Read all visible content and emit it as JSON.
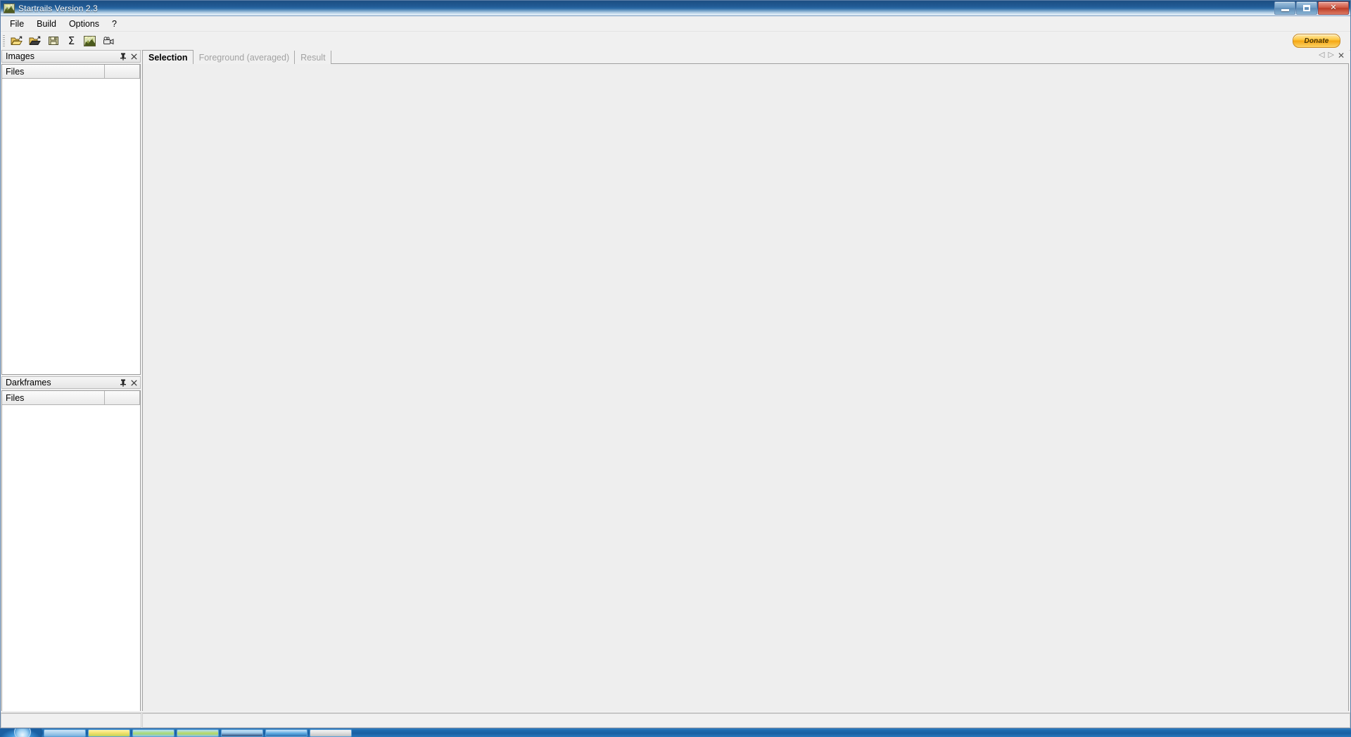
{
  "window": {
    "title": "Startrails Version 2.3",
    "icon": "startrails-app-icon",
    "controls": {
      "minimize": "minimize-button",
      "maximize": "maximize-restore-button",
      "close": "close-button"
    }
  },
  "menubar": {
    "items": [
      {
        "label": "File",
        "name": "menu-file"
      },
      {
        "label": "Build",
        "name": "menu-build"
      },
      {
        "label": "Options",
        "name": "menu-options"
      },
      {
        "label": "?",
        "name": "menu-help"
      }
    ]
  },
  "toolbar": {
    "buttons": [
      {
        "name": "open-images-button",
        "icon": "open-folder-icon",
        "tooltip": "Open images"
      },
      {
        "name": "open-darkframes-button",
        "icon": "open-folder-icon",
        "tooltip": "Open darkframes"
      },
      {
        "name": "save-button",
        "icon": "floppy-disk-save-icon",
        "tooltip": "Save"
      },
      {
        "name": "sum-button",
        "icon": "sigma-sum-icon",
        "tooltip": "Build startrails"
      },
      {
        "name": "startrails-button",
        "icon": "startrails-image-icon",
        "tooltip": "Startrails"
      },
      {
        "name": "video-button",
        "icon": "video-camera-icon",
        "tooltip": "Create video"
      }
    ],
    "donate": {
      "label": "Donate",
      "name": "donate-button",
      "color": "#f5a714"
    }
  },
  "panels": {
    "images": {
      "title": "Images",
      "pin": "pin-icon",
      "close": "close-icon",
      "columns": [
        "Files",
        ""
      ],
      "rows": []
    },
    "darkframes": {
      "title": "Darkframes",
      "pin": "pin-icon",
      "close": "close-icon",
      "columns": [
        "Files",
        ""
      ],
      "rows": []
    }
  },
  "main": {
    "tabs": [
      {
        "label": "Selection",
        "name": "tab-selection",
        "active": true
      },
      {
        "label": "Foreground (averaged)",
        "name": "tab-foreground-averaged",
        "active": false
      },
      {
        "label": "Result",
        "name": "tab-result",
        "active": false
      }
    ],
    "tab_nav": {
      "prev": "chevron-left-icon",
      "next": "chevron-right-icon",
      "close": "close-icon"
    },
    "content": ""
  },
  "statusbar": {
    "left": "",
    "right": ""
  },
  "taskbar": {
    "start": "start-orb-icon",
    "items": [
      {
        "name": "taskbar-item-1",
        "label": ""
      },
      {
        "name": "taskbar-item-2",
        "label": ""
      },
      {
        "name": "taskbar-item-3",
        "label": ""
      },
      {
        "name": "taskbar-item-4",
        "label": ""
      },
      {
        "name": "taskbar-item-5",
        "label": ""
      },
      {
        "name": "taskbar-item-6",
        "label": ""
      },
      {
        "name": "taskbar-item-7",
        "label": ""
      }
    ]
  },
  "colors": {
    "titlebar_blue": "#215a94",
    "app_bg": "#f0f0f0",
    "content_bg": "#eeeeee",
    "inactive_tab_text": "#a2a2a2",
    "accent_orange": "#f5a714"
  }
}
